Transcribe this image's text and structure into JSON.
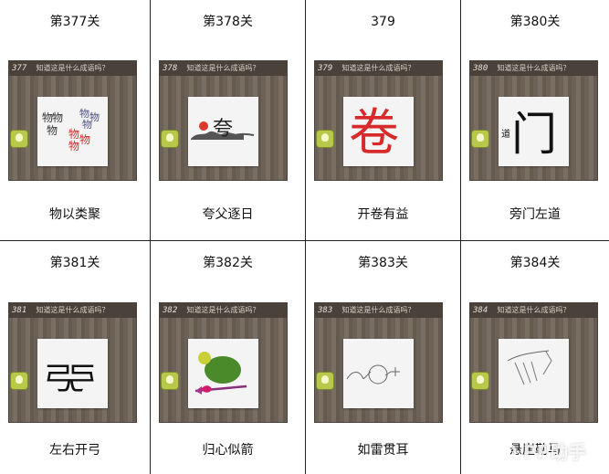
{
  "cards": [
    {
      "title": "第377关",
      "number": "377",
      "question": "知道这是什么成语吗？",
      "answer": "物以类聚"
    },
    {
      "title": "第378关",
      "number": "378",
      "question": "知道这是什么成语吗？",
      "answer": "夸父逐日"
    },
    {
      "title": "379",
      "number": "379",
      "question": "知道这是什么成语吗？",
      "answer": "开卷有益"
    },
    {
      "title": "第380关",
      "number": "380",
      "question": "知道这是什么成语吗？",
      "answer": "旁门左道"
    },
    {
      "title": "第381关",
      "number": "381",
      "question": "知道这是什么成语吗？",
      "answer": "左右开弓"
    },
    {
      "title": "第382关",
      "number": "382",
      "question": "知道这是什么成语吗？",
      "answer": "归心似箭"
    },
    {
      "title": "第383关",
      "number": "383",
      "question": "知道这是什么成语吗？",
      "answer": "如雷贯耳"
    },
    {
      "title": "第384关",
      "number": "384",
      "question": "知道这是什么成语吗？",
      "answer": "悬崖勒马"
    }
  ],
  "puzzles": {
    "p377_main": "物",
    "p378_main": "夸",
    "p379_main": "卷",
    "p380_small": "道",
    "p380_main": "门",
    "p381_main": "弓"
  },
  "watermark": {
    "text": "PP助手"
  }
}
